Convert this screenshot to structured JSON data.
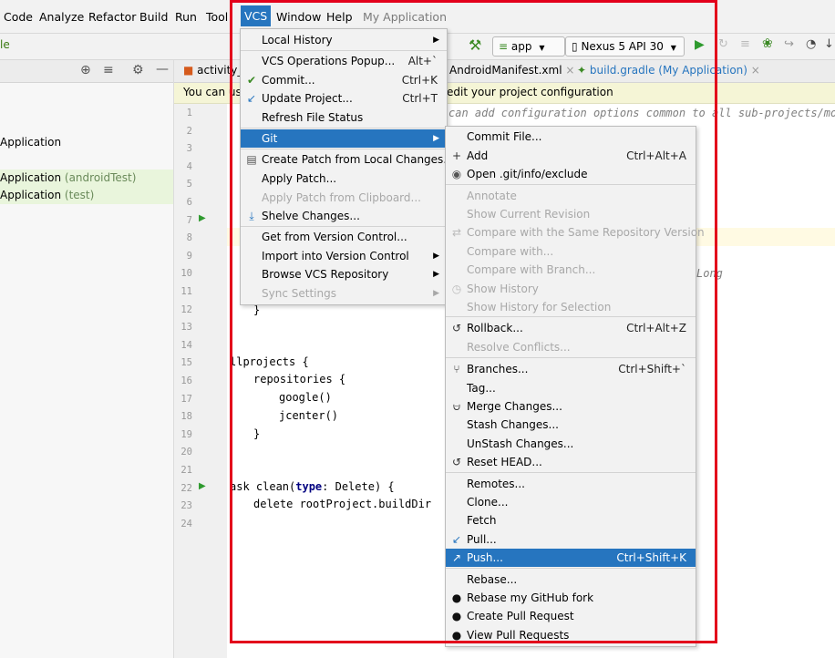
{
  "menubar": {
    "items": [
      "Code",
      "Analyze",
      "Refactor",
      "Build",
      "Run",
      "Tool",
      "VCS",
      "Window",
      "Help"
    ],
    "app_title": "My Application"
  },
  "toolbar": {
    "left_label": "le",
    "run_config": "app",
    "device": "Nexus 5 API 30"
  },
  "project_panel": {
    "rows": [
      {
        "name": "Application",
        "suffix": ""
      },
      {
        "name": "Application",
        "suffix": "(androidTest)"
      },
      {
        "name": "Application",
        "suffix": "(test)"
      }
    ]
  },
  "editor": {
    "tabs": [
      "activity_",
      "AndroidManifest.xml",
      "build.gradle (My Application)"
    ],
    "banner": "You can use this file to edit your project configuration",
    "banner_left": "You can us",
    "banner_right": "edit your project configuration",
    "line_numbers": [
      "1",
      "2",
      "3",
      "4",
      "5",
      "6",
      "7",
      "8",
      "9",
      "10",
      "11",
      "12",
      "13",
      "14",
      "15",
      "16",
      "17",
      "18",
      "19",
      "20",
      "21",
      "22",
      "23",
      "24"
    ],
    "comment_line": "can add configuration options common to all sub-projects/modu",
    "long_fragment": "Long",
    "code": {
      "brace_close": "}",
      "allprojects": "llprojects {",
      "repositories": "repositories {",
      "google": "google()",
      "jcenter": "jcenter()",
      "close_inner": "}",
      "task_prefix": "ask clean(",
      "task_kw": "type",
      "task_suffix": ": Delete) {",
      "delete": "delete rootProject.buildDir"
    }
  },
  "vcs_menu": {
    "items": [
      {
        "label": "Local History",
        "shortcut": "",
        "submenu": true,
        "disabled": false,
        "icon": ""
      },
      {
        "label": "VCS Operations Popup...",
        "shortcut": "Alt+`",
        "submenu": false,
        "disabled": false,
        "icon": ""
      },
      {
        "label": "Commit...",
        "shortcut": "Ctrl+K",
        "submenu": false,
        "disabled": false,
        "icon": "check-icon"
      },
      {
        "label": "Update Project...",
        "shortcut": "Ctrl+T",
        "submenu": false,
        "disabled": false,
        "icon": "update-arrow-icon"
      },
      {
        "label": "Refresh File Status",
        "shortcut": "",
        "submenu": false,
        "disabled": false,
        "icon": ""
      },
      {
        "label": "Git",
        "shortcut": "",
        "submenu": true,
        "disabled": false,
        "icon": "",
        "selected": true
      },
      {
        "label": "Create Patch from Local Changes...",
        "shortcut": "",
        "submenu": false,
        "disabled": false,
        "icon": "patch-icon"
      },
      {
        "label": "Apply Patch...",
        "shortcut": "",
        "submenu": false,
        "disabled": false,
        "icon": ""
      },
      {
        "label": "Apply Patch from Clipboard...",
        "shortcut": "",
        "submenu": false,
        "disabled": true,
        "icon": ""
      },
      {
        "label": "Shelve Changes...",
        "shortcut": "",
        "submenu": false,
        "disabled": false,
        "icon": "shelve-icon"
      },
      {
        "label": "Get from Version Control...",
        "shortcut": "",
        "submenu": false,
        "disabled": false,
        "icon": ""
      },
      {
        "label": "Import into Version Control",
        "shortcut": "",
        "submenu": true,
        "disabled": false,
        "icon": ""
      },
      {
        "label": "Browse VCS Repository",
        "shortcut": "",
        "submenu": true,
        "disabled": false,
        "icon": ""
      },
      {
        "label": "Sync Settings",
        "shortcut": "",
        "submenu": true,
        "disabled": true,
        "icon": ""
      }
    ]
  },
  "git_menu": {
    "items": [
      {
        "label": "Commit File...",
        "shortcut": "",
        "disabled": false,
        "icon": ""
      },
      {
        "label": "Add",
        "shortcut": "Ctrl+Alt+A",
        "disabled": false,
        "icon": "plus-icon"
      },
      {
        "label": "Open .git/info/exclude",
        "shortcut": "",
        "disabled": false,
        "icon": "git-file-icon"
      },
      {
        "label": "Annotate",
        "shortcut": "",
        "disabled": true,
        "icon": ""
      },
      {
        "label": "Show Current Revision",
        "shortcut": "",
        "disabled": true,
        "icon": ""
      },
      {
        "label": "Compare with the Same Repository Version",
        "shortcut": "",
        "disabled": true,
        "icon": "compare-icon"
      },
      {
        "label": "Compare with...",
        "shortcut": "",
        "disabled": true,
        "icon": ""
      },
      {
        "label": "Compare with Branch...",
        "shortcut": "",
        "disabled": true,
        "icon": ""
      },
      {
        "label": "Show History",
        "shortcut": "",
        "disabled": true,
        "icon": "clock-icon"
      },
      {
        "label": "Show History for Selection",
        "shortcut": "",
        "disabled": true,
        "icon": ""
      },
      {
        "label": "Rollback...",
        "shortcut": "Ctrl+Alt+Z",
        "disabled": false,
        "icon": "rollback-icon"
      },
      {
        "label": "Resolve Conflicts...",
        "shortcut": "",
        "disabled": true,
        "icon": ""
      },
      {
        "label": "Branches...",
        "shortcut": "Ctrl+Shift+`",
        "disabled": false,
        "icon": "branch-icon"
      },
      {
        "label": "Tag...",
        "shortcut": "",
        "disabled": false,
        "icon": ""
      },
      {
        "label": "Merge Changes...",
        "shortcut": "",
        "disabled": false,
        "icon": "merge-icon"
      },
      {
        "label": "Stash Changes...",
        "shortcut": "",
        "disabled": false,
        "icon": ""
      },
      {
        "label": "UnStash Changes...",
        "shortcut": "",
        "disabled": false,
        "icon": ""
      },
      {
        "label": "Reset HEAD...",
        "shortcut": "",
        "disabled": false,
        "icon": "reset-icon"
      },
      {
        "label": "Remotes...",
        "shortcut": "",
        "disabled": false,
        "icon": ""
      },
      {
        "label": "Clone...",
        "shortcut": "",
        "disabled": false,
        "icon": ""
      },
      {
        "label": "Fetch",
        "shortcut": "",
        "disabled": false,
        "icon": ""
      },
      {
        "label": "Pull...",
        "shortcut": "",
        "disabled": false,
        "icon": "pull-arrow-icon"
      },
      {
        "label": "Push...",
        "shortcut": "Ctrl+Shift+K",
        "disabled": false,
        "icon": "push-arrow-icon",
        "selected": true
      },
      {
        "label": "Rebase...",
        "shortcut": "",
        "disabled": false,
        "icon": ""
      },
      {
        "label": "Rebase my GitHub fork",
        "shortcut": "",
        "disabled": false,
        "icon": "github-icon"
      },
      {
        "label": "Create Pull Request",
        "shortcut": "",
        "disabled": false,
        "icon": "github-icon"
      },
      {
        "label": "View Pull Requests",
        "shortcut": "",
        "disabled": false,
        "icon": "github-icon"
      }
    ]
  },
  "colors": {
    "selection": "#2675bf",
    "highlight_box": "#e3001b",
    "menu_bg": "#f2f2f2"
  }
}
